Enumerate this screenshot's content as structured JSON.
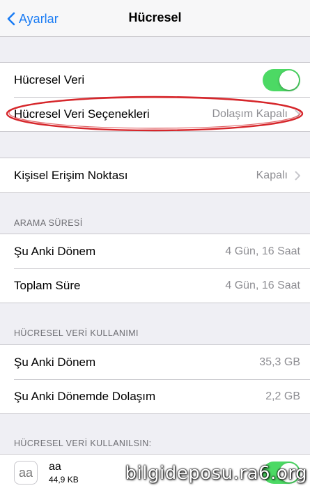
{
  "nav": {
    "back_label": "Ayarlar",
    "title": "Hücresel"
  },
  "group1": {
    "cellular_data": {
      "label": "Hücresel Veri",
      "toggle_on": true
    },
    "cellular_options": {
      "label": "Hücresel Veri Seçenekleri",
      "value": "Dolaşım Kapalı"
    }
  },
  "hotspot": {
    "label": "Kişisel Erişim Noktası",
    "value": "Kapalı"
  },
  "call_time": {
    "header": "ARAMA SÜRESİ",
    "rows": [
      {
        "label": "Şu Anki Dönem",
        "value": "4 Gün, 16 Saat"
      },
      {
        "label": "Toplam Süre",
        "value": "4 Gün, 16 Saat"
      }
    ]
  },
  "data_usage": {
    "header": "HÜCRESEL VERİ KULLANIMI",
    "rows": [
      {
        "label": "Şu Anki Dönem",
        "value": "35,3 GB"
      },
      {
        "label": "Şu Anki Dönemde Dolaşım",
        "value": "2,2 GB"
      }
    ]
  },
  "apps": {
    "header": "HÜCRESEL VERİ KULLANILSIN:",
    "items": [
      {
        "icon_text": "aa",
        "name": "aa",
        "size": "44,9 KB",
        "toggle_on": true
      }
    ]
  },
  "watermark": "bilgideposu.ra6.org",
  "colors": {
    "accent": "#1a7cf4",
    "toggle_on": "#4cd964",
    "highlight_ellipse": "#d6262b"
  }
}
